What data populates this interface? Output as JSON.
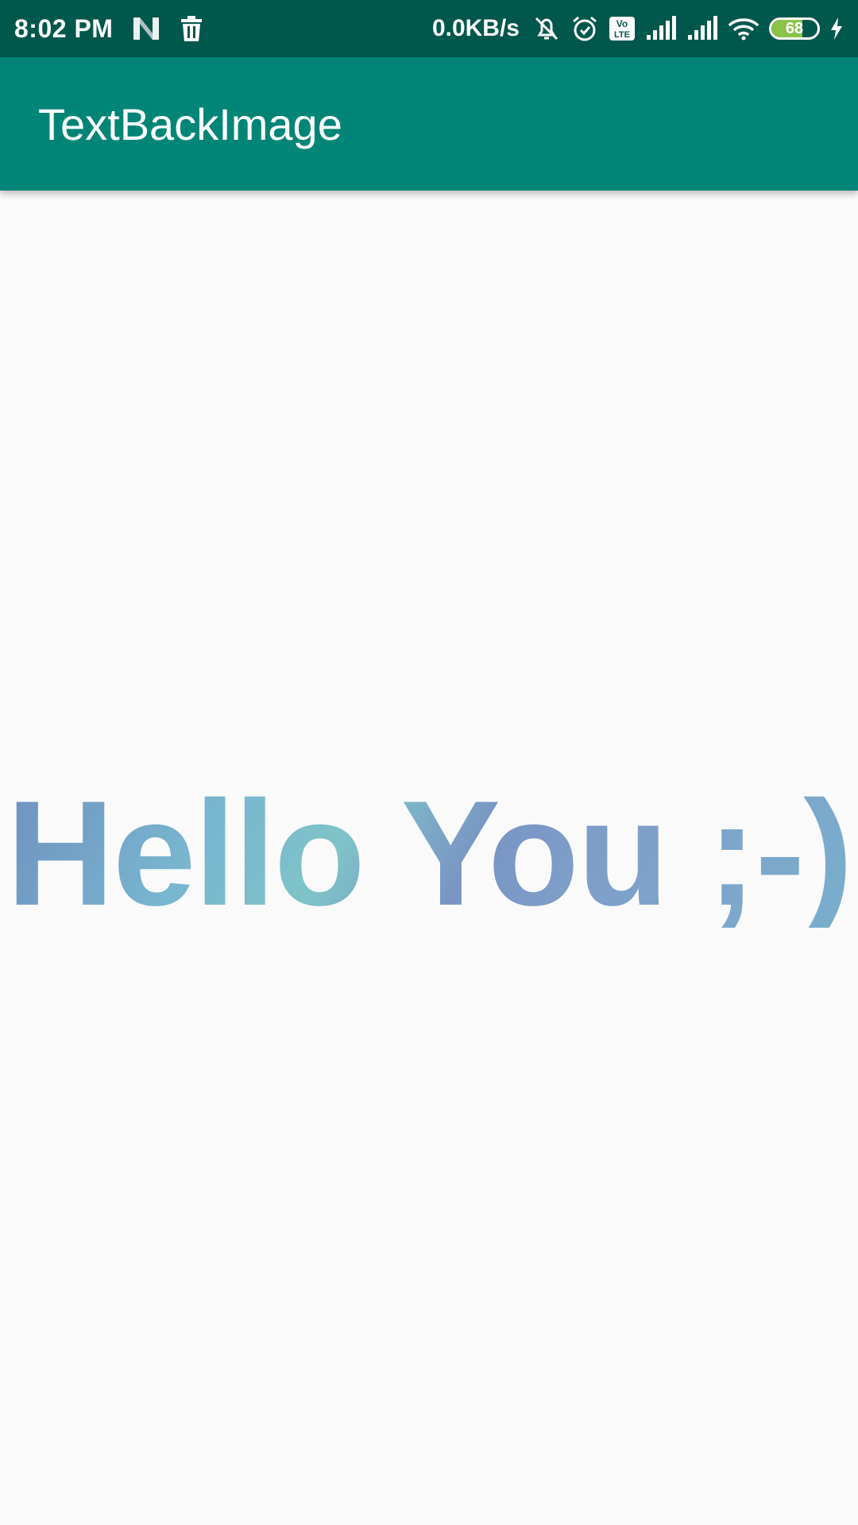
{
  "status_bar": {
    "time": "8:02 PM",
    "net_speed": "0.0KB/s",
    "battery_level": "68",
    "icons": [
      "n-logo-icon",
      "trash-icon",
      "mute-bell-icon",
      "alarm-icon",
      "volte-icon",
      "signal-icon",
      "signal-icon",
      "wifi-icon",
      "battery-icon",
      "charging-icon"
    ]
  },
  "app_bar": {
    "title": "TextBackImage"
  },
  "main": {
    "text": "Hello You ;-)"
  },
  "colors": {
    "status_bar": "#00574b",
    "app_bar": "#008577",
    "background": "#fafafa",
    "text_image_tint": "#7aa6c8",
    "battery_fill": "#8bc34a"
  }
}
